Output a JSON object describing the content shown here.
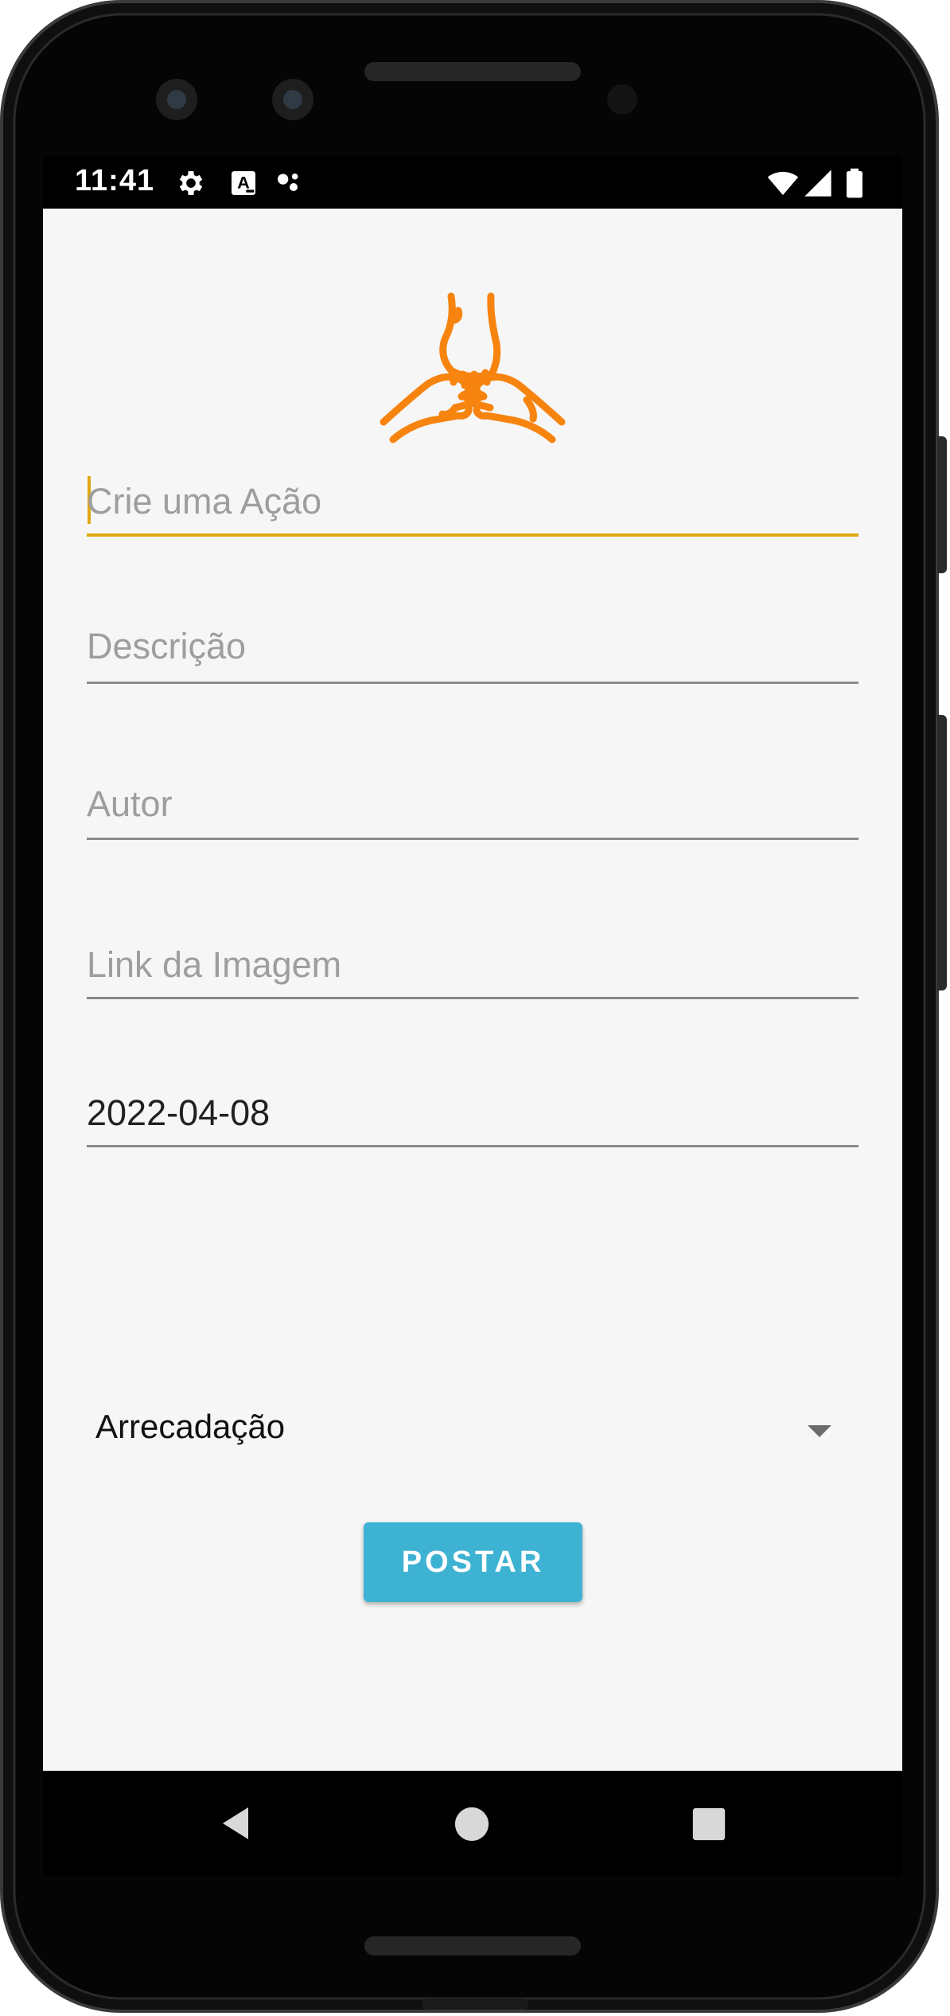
{
  "status_bar": {
    "time": "11:41",
    "icons": [
      "gear-icon",
      "a-keyboard-icon",
      "assistant-dots-icon",
      "wifi-icon",
      "signal-icon",
      "battery-icon"
    ]
  },
  "form": {
    "title_field": {
      "placeholder": "Crie uma Ação",
      "focused": true
    },
    "description_field": {
      "placeholder": "Descrição"
    },
    "author_field": {
      "placeholder": "Autor"
    },
    "image_link_field": {
      "placeholder": "Link da Imagem"
    },
    "date_field": {
      "value": "2022-04-08"
    },
    "category_select": {
      "selected": "Arrecadação"
    },
    "post_button": {
      "label": "POSTAR"
    }
  },
  "navigation": {
    "icons": [
      "back-triangle-icon",
      "home-circle-icon",
      "recents-square-icon"
    ]
  },
  "colors": {
    "logo_orange": "#f7840f",
    "accent_focus": "#e0a816",
    "button_blue": "#3eb2d2",
    "background": "#f6f6f6"
  }
}
